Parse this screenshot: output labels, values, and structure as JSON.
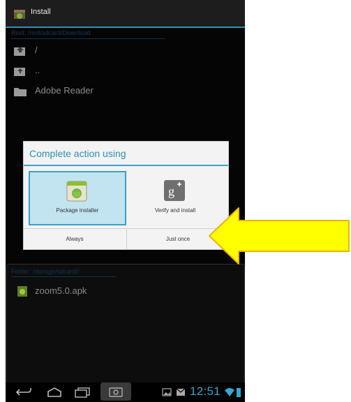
{
  "titlebar": {
    "title": "Install"
  },
  "browser": {
    "path": "Root: /mnt/sdcard/Download",
    "items": [
      {
        "label": "/",
        "icon": "folder-up-icon"
      },
      {
        "label": "..",
        "icon": "folder-up-icon"
      },
      {
        "label": "Adobe Reader",
        "icon": "folder-icon"
      }
    ]
  },
  "lower_panel": {
    "path": "Folder: /storage/sdcard0",
    "items": [
      {
        "label": "zoom5.0.apk",
        "icon": "apk-file-icon"
      }
    ]
  },
  "dialog": {
    "title": "Complete action using",
    "options": [
      {
        "label": "Package installer",
        "icon": "package-installer-icon",
        "selected": true
      },
      {
        "label": "Verify and install",
        "icon": "google-plus-icon",
        "selected": false
      }
    ],
    "buttons": {
      "always": "Always",
      "just_once": "Just once"
    }
  },
  "statusbar": {
    "time": "12:51"
  },
  "colors": {
    "accent": "#33b5e5",
    "highlight_arrow": "#ffff00"
  }
}
